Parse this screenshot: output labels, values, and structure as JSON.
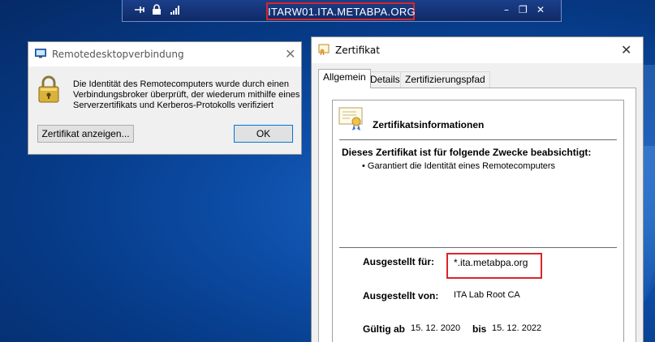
{
  "rdp_bar": {
    "hostname": "ITARW01.ITA.METABPA.ORG",
    "icons": [
      "pin-icon",
      "lock-icon",
      "signal-bars-icon"
    ],
    "controls": [
      "minimize-icon",
      "restore-icon",
      "close-icon"
    ],
    "minimize_glyph": "–",
    "restore_glyph": "❐",
    "close_glyph": "✕"
  },
  "rdc_dialog": {
    "title": "Remotedesktopverbindung",
    "close_glyph": "✕",
    "message": "Die Identität des Remotecomputers wurde durch einen Verbindungsbroker überprüft, der wiederum mithilfe eines Serverzertifikats und Kerberos-Protokolls verifiziert",
    "show_cert_button": "Zertifikat anzeigen...",
    "ok_button": "OK"
  },
  "cert_dialog": {
    "title": "Zertifikat",
    "close_glyph": "✕",
    "tabs": [
      "Allgemein",
      "Details",
      "Zertifizierungspfad"
    ],
    "active_tab": "Allgemein",
    "info_heading": "Zertifikatsinformationen",
    "purpose_heading": "Dieses Zertifikat ist für folgende Zwecke beabsichtigt:",
    "purpose_items": [
      "• Garantiert die Identität eines Remotecomputers"
    ],
    "issued_to_label": "Ausgestellt für:",
    "issued_to_value": "*.ita.metabpa.org",
    "issued_by_label": "Ausgestellt von:",
    "issued_by_value": "ITA Lab Root CA",
    "valid_from_label": "Gültig ab",
    "valid_from_value": "15. 12. 2020",
    "valid_to_label": "bis",
    "valid_to_value": "15. 12. 2022"
  },
  "colors": {
    "highlight": "#d9252b",
    "accent": "#0078d7",
    "desktop": "#0d4ea8"
  }
}
